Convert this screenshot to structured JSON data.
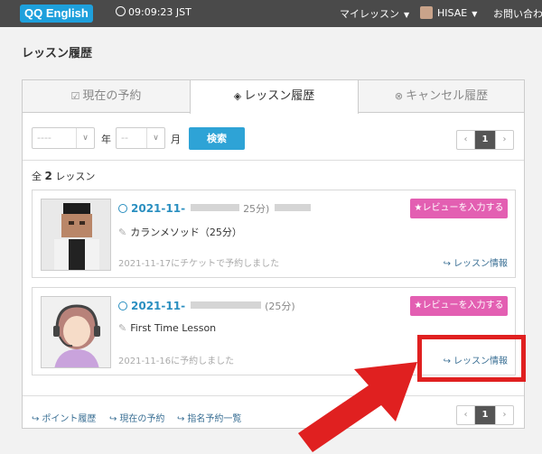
{
  "header": {
    "logo": "QQ English",
    "time": "09:09:23 JST",
    "nav": [
      {
        "label": "マイレッスン"
      },
      {
        "label": "HISAE"
      },
      {
        "label": "お問い合わせ"
      }
    ]
  },
  "page_title": "レッスン履歴",
  "tabs": [
    {
      "label": "現在の予約"
    },
    {
      "label": "レッスン履歴",
      "active": true
    },
    {
      "label": "キャンセル履歴"
    }
  ],
  "filter": {
    "year_placeholder": "----",
    "year_unit": "年",
    "month_placeholder": "--",
    "month_unit": "月",
    "search_label": "検索"
  },
  "pager": {
    "prev": "‹",
    "page": "1",
    "next": "›"
  },
  "count": {
    "prefix": "全",
    "number": "2",
    "suffix": "レッスン"
  },
  "lessons": [
    {
      "datetime": "2021-11-",
      "duration": "25分)",
      "course": "カランメソッド（25分）",
      "booked": "2021-11-17にチケットで予約しました",
      "review": "★レビューを入力する",
      "info": "レッスン情報"
    },
    {
      "datetime": "2021-11-",
      "duration": "(25分)",
      "course": "First Time Lesson",
      "booked": "2021-11-16に予約しました",
      "review": "★レビューを入力する",
      "info": "レッスン情報"
    }
  ],
  "footer_links": [
    {
      "label": "ポイント履歴"
    },
    {
      "label": "現在の予約"
    },
    {
      "label": "指名予約一覧"
    }
  ],
  "colors": {
    "accent": "#2ea3d6",
    "review": "#e35fb2",
    "highlight": "#e02020"
  }
}
